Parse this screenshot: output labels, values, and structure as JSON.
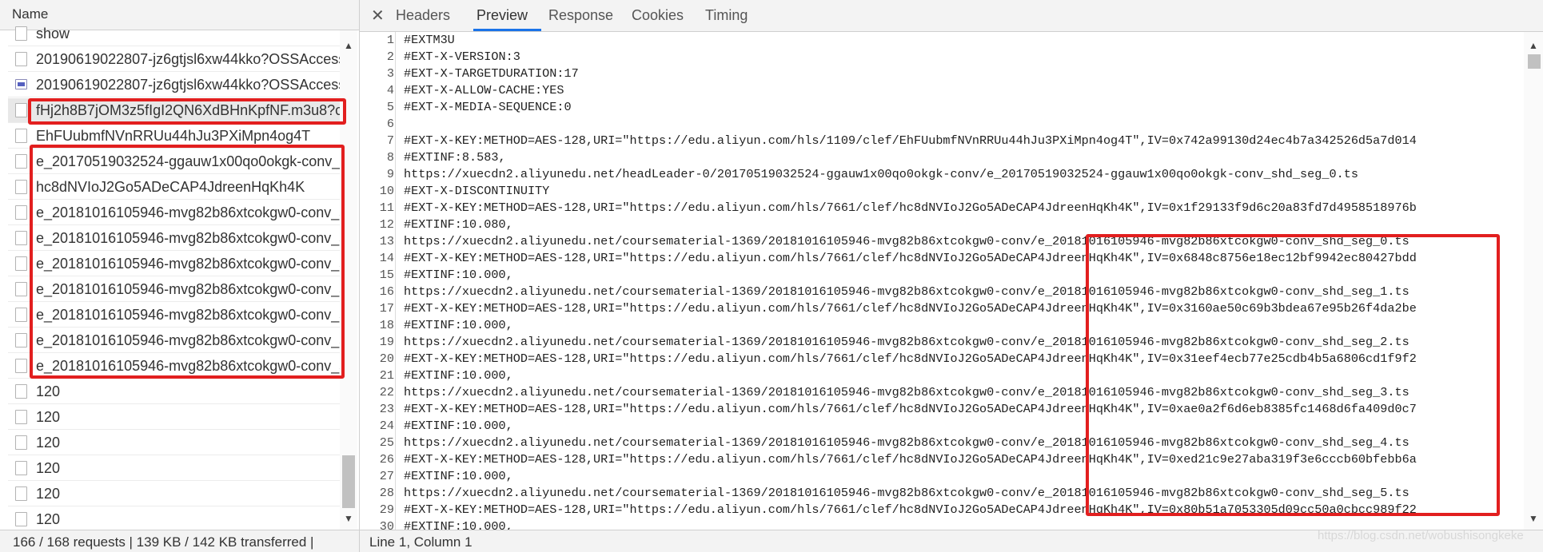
{
  "left_panel": {
    "header": "Name",
    "rows": [
      {
        "name": "show",
        "icon": "checkbox"
      },
      {
        "name": "20190619022807-jz6gtjsl6xw44kko?OSSAccessK",
        "icon": "checkbox"
      },
      {
        "name": "20190619022807-jz6gtjsl6xw44kko?OSSAccessK",
        "icon": "image-file-icon"
      },
      {
        "name": "fHj2h8B7jOM3z5fIgI2QN6XdBHnKpfNF.m3u8?c.",
        "icon": "checkbox",
        "selected": true
      },
      {
        "name": "EhFUubmfNVnRRUu44hJu3PXiMpn4og4T",
        "icon": "checkbox"
      },
      {
        "name": "e_20170519032524-ggauw1x00qo0okgk-conv_s",
        "icon": "checkbox"
      },
      {
        "name": "hc8dNVIoJ2Go5ADeCAP4JdreenHqKh4K",
        "icon": "checkbox"
      },
      {
        "name": "e_20181016105946-mvg82b86xtcokgw0-conv_s",
        "icon": "checkbox"
      },
      {
        "name": "e_20181016105946-mvg82b86xtcokgw0-conv_s",
        "icon": "checkbox"
      },
      {
        "name": "e_20181016105946-mvg82b86xtcokgw0-conv_s",
        "icon": "checkbox"
      },
      {
        "name": "e_20181016105946-mvg82b86xtcokgw0-conv_s",
        "icon": "checkbox"
      },
      {
        "name": "e_20181016105946-mvg82b86xtcokgw0-conv_s",
        "icon": "checkbox"
      },
      {
        "name": "e_20181016105946-mvg82b86xtcokgw0-conv_s",
        "icon": "checkbox"
      },
      {
        "name": "e_20181016105946-mvg82b86xtcokgw0-conv_s",
        "icon": "checkbox"
      },
      {
        "name": "120",
        "icon": "checkbox"
      },
      {
        "name": "120",
        "icon": "checkbox"
      },
      {
        "name": "120",
        "icon": "checkbox"
      },
      {
        "name": "120",
        "icon": "checkbox"
      },
      {
        "name": "120",
        "icon": "checkbox"
      },
      {
        "name": "120",
        "icon": "checkbox"
      }
    ],
    "status": "166 / 168 requests | 139 KB / 142 KB transferred |"
  },
  "right_panel": {
    "close_icon": "close-icon",
    "tabs": [
      "Headers",
      "Preview",
      "Response",
      "Cookies",
      "Timing"
    ],
    "active_tab": "Preview",
    "line_numbers": [
      "1",
      "2",
      "3",
      "4",
      "5",
      "6",
      "7",
      "8",
      "9",
      "10",
      "11",
      "12",
      "13",
      "14",
      "15",
      "16",
      "17",
      "18",
      "19",
      "20",
      "21",
      "22",
      "23",
      "24",
      "25",
      "26",
      "27",
      "28",
      "29",
      "30"
    ],
    "lines": [
      "#EXTM3U",
      "#EXT-X-VERSION:3",
      "#EXT-X-TARGETDURATION:17",
      "#EXT-X-ALLOW-CACHE:YES",
      "#EXT-X-MEDIA-SEQUENCE:0",
      "",
      "#EXT-X-KEY:METHOD=AES-128,URI=\"https://edu.aliyun.com/hls/1109/clef/EhFUubmfNVnRRUu44hJu3PXiMpn4og4T\",IV=0x742a99130d24ec4b7a342526d5a7d014",
      "#EXTINF:8.583,",
      "https://xuecdn2.aliyunedu.net/headLeader-0/20170519032524-ggauw1x00qo0okgk-conv/e_20170519032524-ggauw1x00qo0okgk-conv_shd_seg_0.ts",
      "#EXT-X-DISCONTINUITY",
      "#EXT-X-KEY:METHOD=AES-128,URI=\"https://edu.aliyun.com/hls/7661/clef/hc8dNVIoJ2Go5ADeCAP4JdreenHqKh4K\",IV=0x1f29133f9d6c20a83fd7d4958518976b",
      "#EXTINF:10.080,",
      "https://xuecdn2.aliyunedu.net/coursematerial-1369/20181016105946-mvg82b86xtcokgw0-conv/e_20181016105946-mvg82b86xtcokgw0-conv_shd_seg_0.ts",
      "#EXT-X-KEY:METHOD=AES-128,URI=\"https://edu.aliyun.com/hls/7661/clef/hc8dNVIoJ2Go5ADeCAP4JdreenHqKh4K\",IV=0x6848c8756e18ec12bf9942ec80427bdd",
      "#EXTINF:10.000,",
      "https://xuecdn2.aliyunedu.net/coursematerial-1369/20181016105946-mvg82b86xtcokgw0-conv/e_20181016105946-mvg82b86xtcokgw0-conv_shd_seg_1.ts",
      "#EXT-X-KEY:METHOD=AES-128,URI=\"https://edu.aliyun.com/hls/7661/clef/hc8dNVIoJ2Go5ADeCAP4JdreenHqKh4K\",IV=0x3160ae50c69b3bdea67e95b26f4da2be",
      "#EXTINF:10.000,",
      "https://xuecdn2.aliyunedu.net/coursematerial-1369/20181016105946-mvg82b86xtcokgw0-conv/e_20181016105946-mvg82b86xtcokgw0-conv_shd_seg_2.ts",
      "#EXT-X-KEY:METHOD=AES-128,URI=\"https://edu.aliyun.com/hls/7661/clef/hc8dNVIoJ2Go5ADeCAP4JdreenHqKh4K\",IV=0x31eef4ecb77e25cdb4b5a6806cd1f9f2",
      "#EXTINF:10.000,",
      "https://xuecdn2.aliyunedu.net/coursematerial-1369/20181016105946-mvg82b86xtcokgw0-conv/e_20181016105946-mvg82b86xtcokgw0-conv_shd_seg_3.ts",
      "#EXT-X-KEY:METHOD=AES-128,URI=\"https://edu.aliyun.com/hls/7661/clef/hc8dNVIoJ2Go5ADeCAP4JdreenHqKh4K\",IV=0xae0a2f6d6eb8385fc1468d6fa409d0c7",
      "#EXTINF:10.000,",
      "https://xuecdn2.aliyunedu.net/coursematerial-1369/20181016105946-mvg82b86xtcokgw0-conv/e_20181016105946-mvg82b86xtcokgw0-conv_shd_seg_4.ts",
      "#EXT-X-KEY:METHOD=AES-128,URI=\"https://edu.aliyun.com/hls/7661/clef/hc8dNVIoJ2Go5ADeCAP4JdreenHqKh4K\",IV=0xed21c9e27aba319f3e6cccb60bfebb6a",
      "#EXTINF:10.000,",
      "https://xuecdn2.aliyunedu.net/coursematerial-1369/20181016105946-mvg82b86xtcokgw0-conv/e_20181016105946-mvg82b86xtcokgw0-conv_shd_seg_5.ts",
      "#EXT-X-KEY:METHOD=AES-128,URI=\"https://edu.aliyun.com/hls/7661/clef/hc8dNVIoJ2Go5ADeCAP4JdreenHqKh4K\",IV=0x80b51a7053305d09cc50a0cbcc989f22",
      "#EXTINF:10.000,"
    ],
    "status": "Line 1, Column 1"
  },
  "watermark": "https://blog.csdn.net/wobushisongkeke",
  "colors": {
    "highlight": "#e21f1f",
    "tab_accent": "#1a73e8",
    "panel_bg": "#f3f3f3"
  }
}
